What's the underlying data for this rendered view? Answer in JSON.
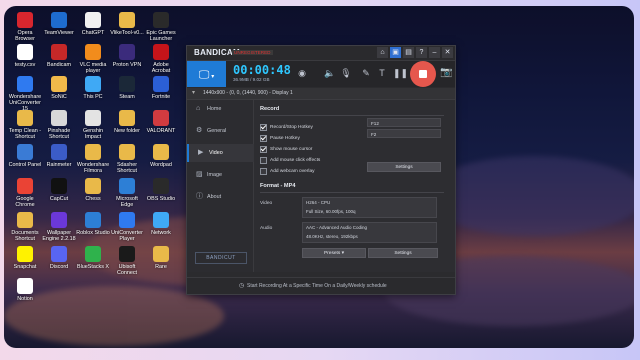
{
  "desktop": {
    "icons": [
      {
        "label": "Opera Browser",
        "color": "#d8262e"
      },
      {
        "label": "TeamViewer",
        "color": "#1e6ccf"
      },
      {
        "label": "ChatGPT",
        "color": "#f1f1f1"
      },
      {
        "label": "VlikeTool-v0...",
        "color": "#e9b949"
      },
      {
        "label": "Epic Games Launcher",
        "color": "#2a2a2a"
      },
      {
        "label": "testy.csv",
        "color": "#ffffff"
      },
      {
        "label": "Bandicam",
        "color": "#c62828"
      },
      {
        "label": "VLC media player",
        "color": "#f28c1c"
      },
      {
        "label": "Proton VPN",
        "color": "#3b2b7c"
      },
      {
        "label": "Adobe Acrobat",
        "color": "#c5141a"
      },
      {
        "label": "Wondershare UniConverter 15",
        "color": "#2f7af0"
      },
      {
        "label": "SoNiC",
        "color": "#f1b94a"
      },
      {
        "label": "This PC",
        "color": "#3fa9f5"
      },
      {
        "label": "Steam",
        "color": "#1b2838"
      },
      {
        "label": "Fortnite",
        "color": "#2b5fd6"
      },
      {
        "label": "Temp Clean - Shortcut",
        "color": "#e9b949"
      },
      {
        "label": "Pinshade Shortcut",
        "color": "#d8d8d8"
      },
      {
        "label": "Genshin Impact",
        "color": "#e3e3e3"
      },
      {
        "label": "New folder",
        "color": "#e9b949"
      },
      {
        "label": "VALORANT",
        "color": "#d13b40"
      },
      {
        "label": "Control Panel",
        "color": "#3a7bd5"
      },
      {
        "label": "Rainmeter",
        "color": "#3b5cc7"
      },
      {
        "label": "Wondershare Filmora",
        "color": "#e9b949"
      },
      {
        "label": "Sdasher Shortcut",
        "color": "#e9b949"
      },
      {
        "label": "Wordpad",
        "color": "#e9b949"
      },
      {
        "label": "Google Chrome",
        "color": "#ea4335"
      },
      {
        "label": "CapCut",
        "color": "#111111"
      },
      {
        "label": "Chess",
        "color": "#e9b949"
      },
      {
        "label": "Microsoft Edge",
        "color": "#2d7fd6"
      },
      {
        "label": "OBS Studio",
        "color": "#2a2a2a"
      },
      {
        "label": "Documents Shortcut",
        "color": "#e9b949"
      },
      {
        "label": "Wallpaper Engine 2.2.18",
        "color": "#6b38d8"
      },
      {
        "label": "Roblox Studio",
        "color": "#2d7fd6"
      },
      {
        "label": "UniConverter Player",
        "color": "#2f7af0"
      },
      {
        "label": "Network",
        "color": "#3fa9f5"
      },
      {
        "label": "Snapchat",
        "color": "#fff200"
      },
      {
        "label": "Discord",
        "color": "#5865f2"
      },
      {
        "label": "BlueStacks X",
        "color": "#2fb24c"
      },
      {
        "label": "Ubisoft Connect",
        "color": "#1a1a1a"
      },
      {
        "label": "Rare",
        "color": "#e9b949"
      },
      {
        "label": "Notion",
        "color": "#ffffff"
      }
    ]
  },
  "app": {
    "brand": "BANDICAM",
    "registration": "UNREGISTERED",
    "toolbar": {
      "timer": "00:00:48",
      "size": "36.9MB / 9.02 GB",
      "mode_icon": "monitor-icon"
    },
    "display_info": "1440x900 - (0, 0, (1440, 900) - Display 1",
    "sidebar": [
      {
        "label": "Home",
        "icon": "home-icon"
      },
      {
        "label": "General",
        "icon": "gear-icon"
      },
      {
        "label": "Video",
        "icon": "video-icon"
      },
      {
        "label": "Image",
        "icon": "image-icon"
      },
      {
        "label": "About",
        "icon": "info-icon"
      }
    ],
    "bandicut": "BANDICUT",
    "record": {
      "title": "Record",
      "options": [
        {
          "label": "Record/Stop Hotkey",
          "checked": true
        },
        {
          "label": "Pause Hotkey",
          "checked": true
        },
        {
          "label": "Show mouse cursor",
          "checked": true
        },
        {
          "label": "Add mouse click effects",
          "checked": false
        },
        {
          "label": "Add webcam overlay",
          "checked": false
        }
      ],
      "hotkey_record": "F12",
      "hotkey_pause": "F2",
      "settings_button": "Settings"
    },
    "format": {
      "title": "Format - MP4",
      "video_label": "Video",
      "video_codec": "H264 - CPU",
      "video_details": "Full Size, 60.00fps, 100q",
      "audio_label": "Audio",
      "audio_codec": "AAC - Advanced Audio Coding",
      "audio_details": "48.0KHz, stereo, 192kbps",
      "presets_button": "Presets",
      "settings_button": "Settings"
    },
    "footer": "Start Recording At a Specific Time On a Daily/Weekly schedule"
  }
}
